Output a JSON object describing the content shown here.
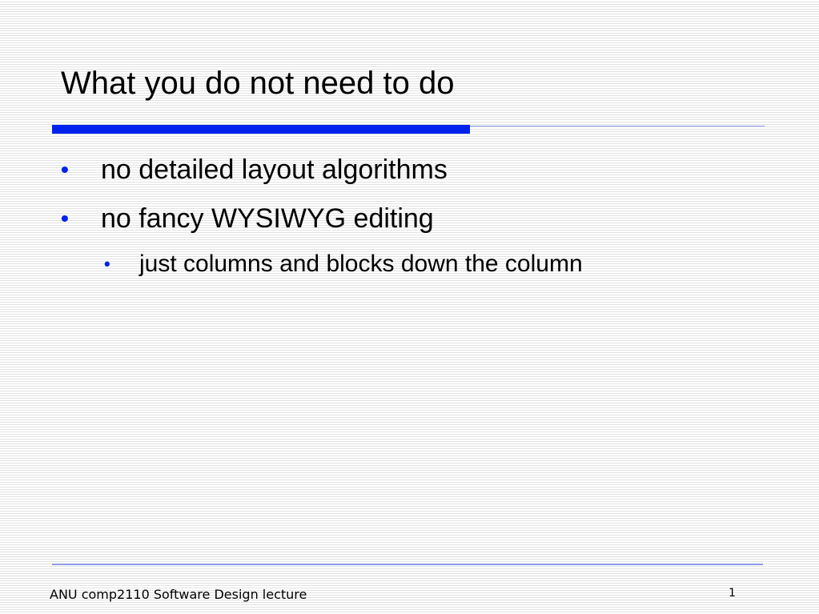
{
  "slide": {
    "title": "What you do not need to do",
    "accent_color": "#0022ee",
    "rule_light_color": "#8a9ae8",
    "bullets": [
      {
        "text": "no detailed layout algorithms",
        "level": 1
      },
      {
        "text": "no fancy WYSIWYG editing",
        "level": 1
      },
      {
        "text": "just columns and blocks down the column",
        "level": 2
      }
    ],
    "bullet_glyph": "•"
  },
  "footer": {
    "text": "ANU comp2110 Software Design lecture",
    "page_number": "1"
  }
}
